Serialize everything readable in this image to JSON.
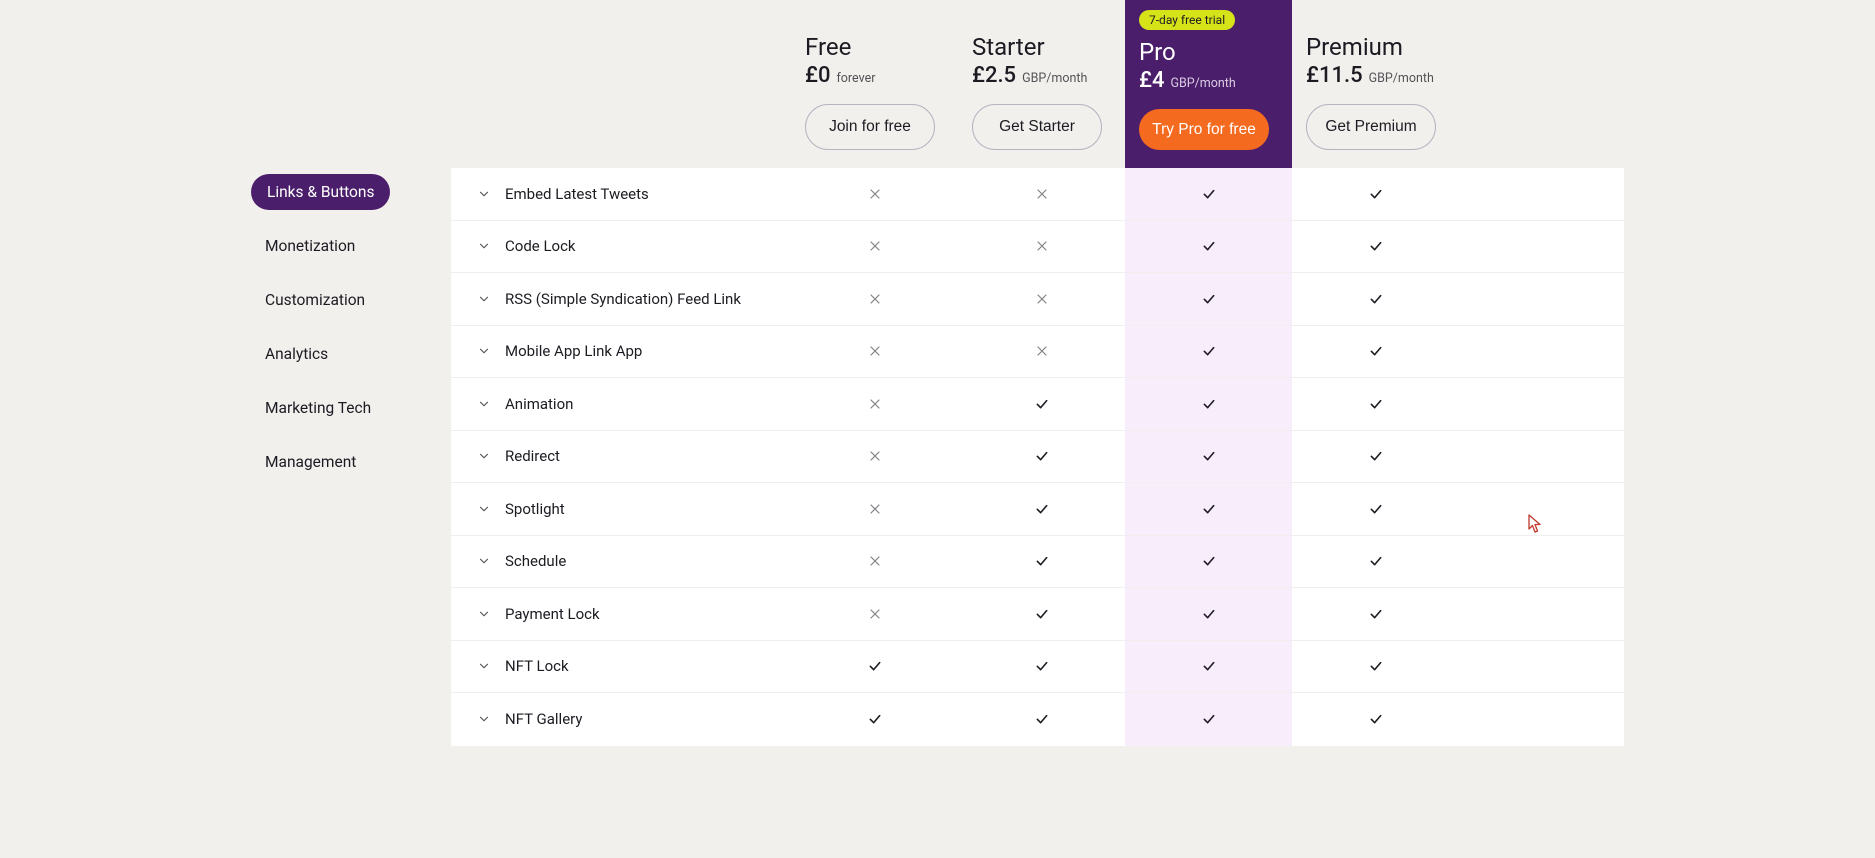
{
  "plans": [
    {
      "id": "free",
      "name": "Free",
      "price": "£0",
      "unit": "forever",
      "cta": "Join for free",
      "highlight": false,
      "badge": null
    },
    {
      "id": "starter",
      "name": "Starter",
      "price": "£2.5",
      "unit": "GBP/month",
      "cta": "Get Starter",
      "highlight": false,
      "badge": null
    },
    {
      "id": "pro",
      "name": "Pro",
      "price": "£4",
      "unit": "GBP/month",
      "cta": "Try Pro for free",
      "highlight": true,
      "badge": "7-day free trial"
    },
    {
      "id": "premium",
      "name": "Premium",
      "price": "£11.5",
      "unit": "GBP/month",
      "cta": "Get Premium",
      "highlight": false,
      "badge": null
    }
  ],
  "sidebar": {
    "items": [
      {
        "label": "Links & Buttons",
        "active": true
      },
      {
        "label": "Monetization",
        "active": false
      },
      {
        "label": "Customization",
        "active": false
      },
      {
        "label": "Analytics",
        "active": false
      },
      {
        "label": "Marketing Tech",
        "active": false
      },
      {
        "label": "Management",
        "active": false
      }
    ]
  },
  "features": [
    {
      "label": "Embed Latest Tweets",
      "values": [
        "x",
        "x",
        "v",
        "v"
      ]
    },
    {
      "label": "Code Lock",
      "values": [
        "x",
        "x",
        "v",
        "v"
      ]
    },
    {
      "label": "RSS (Simple Syndication) Feed Link",
      "values": [
        "x",
        "x",
        "v",
        "v"
      ]
    },
    {
      "label": "Mobile App Link App",
      "values": [
        "x",
        "x",
        "v",
        "v"
      ]
    },
    {
      "label": "Animation",
      "values": [
        "x",
        "v",
        "v",
        "v"
      ]
    },
    {
      "label": "Redirect",
      "values": [
        "x",
        "v",
        "v",
        "v"
      ]
    },
    {
      "label": "Spotlight",
      "values": [
        "x",
        "v",
        "v",
        "v"
      ]
    },
    {
      "label": "Schedule",
      "values": [
        "x",
        "v",
        "v",
        "v"
      ]
    },
    {
      "label": "Payment Lock",
      "values": [
        "x",
        "v",
        "v",
        "v"
      ]
    },
    {
      "label": "NFT Lock",
      "values": [
        "v",
        "v",
        "v",
        "v"
      ]
    },
    {
      "label": "NFT Gallery",
      "values": [
        "v",
        "v",
        "v",
        "v"
      ]
    }
  ]
}
